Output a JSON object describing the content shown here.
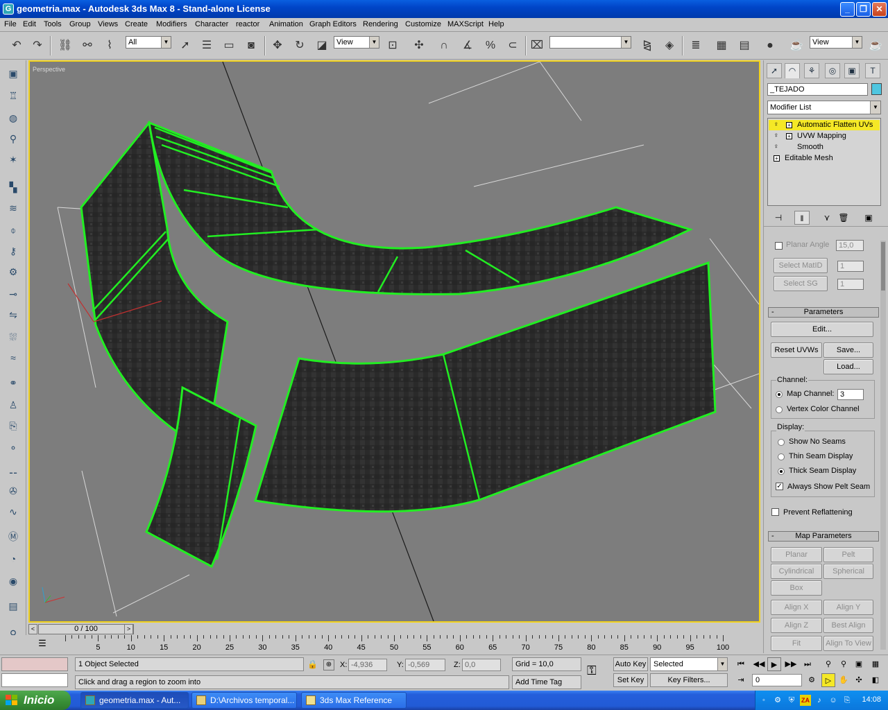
{
  "window": {
    "title": "geometria.max - Autodesk 3ds Max 8  - Stand-alone License",
    "minimize": "_",
    "maximize": "❐",
    "close": "✕"
  },
  "menu": [
    "File",
    "Edit",
    "Tools",
    "Group",
    "Views",
    "Create",
    "Modifiers",
    "Character",
    "reactor",
    "Animation",
    "Graph Editors",
    "Rendering",
    "Customize",
    "MAXScript",
    "Help"
  ],
  "toolbar": {
    "selection_filter": "All",
    "reference_coord": "View",
    "named_selection": "",
    "render_type": "View"
  },
  "viewport": {
    "label": "Perspective",
    "colors": {
      "background": "#7d7d7d",
      "selection": "#22ee22",
      "border": "#f2d21c"
    }
  },
  "command_panel": {
    "object_name": "_TEJADO",
    "object_color": "#4fc6e0",
    "modifier_list": "Modifier List",
    "stack": [
      {
        "label": "Automatic Flatten UVs",
        "expandable": true,
        "selected": true
      },
      {
        "label": "UVW Mapping",
        "expandable": true,
        "selected": false
      },
      {
        "label": "Smooth",
        "expandable": false,
        "selected": false
      },
      {
        "label": "Editable Mesh",
        "expandable": true,
        "selected": false
      }
    ],
    "planar_angle_label": "Planar Angle",
    "planar_angle_value": "15,0",
    "select_matid": "Select MatID",
    "select_matid_value": "1",
    "select_sg": "Select SG",
    "select_sg_value": "1",
    "parameters_title": "Parameters",
    "edit_button": "Edit...",
    "reset_uvws": "Reset UVWs",
    "save": "Save...",
    "load": "Load...",
    "channel_label": "Channel:",
    "map_channel_label": "Map Channel:",
    "map_channel_value": "3",
    "vertex_color_channel": "Vertex Color Channel",
    "display_label": "Display:",
    "show_no_seams": "Show No Seams",
    "thin_seam_display": "Thin Seam Display",
    "thick_seam_display": "Thick Seam Display",
    "always_show_pelt_seam": "Always Show Pelt Seam",
    "prevent_reflattening": "Prevent Reflattening",
    "map_parameters_title": "Map Parameters",
    "map_buttons": [
      "Planar",
      "Pelt",
      "Cylindrical",
      "Spherical",
      "Box"
    ],
    "align_buttons": [
      "Align X",
      "Align Y",
      "Align Z",
      "Best Align",
      "Fit",
      "Align To View"
    ]
  },
  "timeline": {
    "frame_display": "0 / 100",
    "ticks": [
      "5",
      "10",
      "15",
      "20",
      "25",
      "30",
      "35",
      "40",
      "45",
      "50",
      "55",
      "60",
      "65",
      "70",
      "75",
      "80",
      "85",
      "90",
      "95",
      "100"
    ]
  },
  "status": {
    "selection": "1 Object Selected",
    "prompt": "Click and drag a region to zoom into",
    "x_label": "X:",
    "x_value": "-4,936",
    "y_label": "Y:",
    "y_value": "-0,569",
    "z_label": "Z:",
    "z_value": "0,0",
    "grid": "Grid = 10,0",
    "add_time_tag": "Add Time Tag",
    "auto_key": "Auto Key",
    "set_key": "Set Key",
    "key_mode": "Selected",
    "key_filters": "Key Filters...",
    "current_frame": "0"
  },
  "taskbar": {
    "start": "Inicio",
    "items": [
      "geometria.max - Aut...",
      "D:\\Archivos temporal...",
      "3ds Max Reference"
    ],
    "clock": "14:08"
  }
}
